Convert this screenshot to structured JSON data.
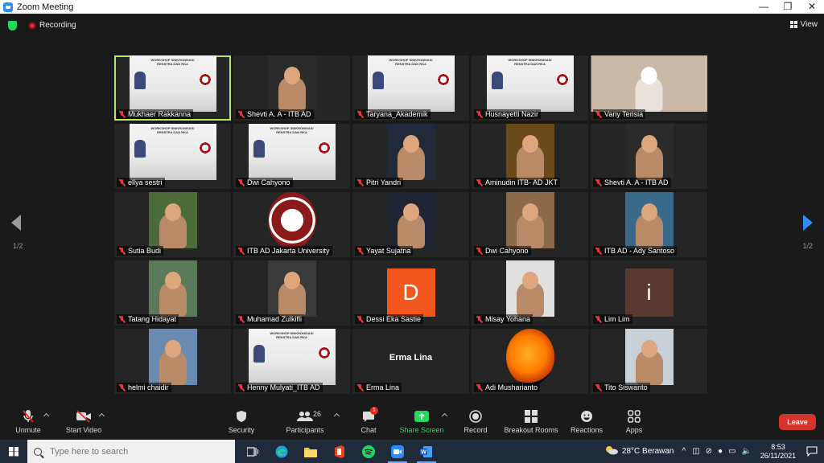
{
  "window": {
    "title": "Zoom Meeting",
    "controls": [
      "—",
      "❐",
      "✕"
    ]
  },
  "topbar": {
    "recording_label": "Recording",
    "view_label": "View"
  },
  "pagination": {
    "left": "1/2",
    "right": "1/2"
  },
  "participants": [
    {
      "name": "Mukhaer Rakkanna",
      "kind": "slide",
      "active": true
    },
    {
      "name": "Shevti A. A - ITB AD",
      "kind": "face",
      "color": "#2b2b2b"
    },
    {
      "name": "Taryana_Akademik",
      "kind": "slide"
    },
    {
      "name": "Husnayetti Nazir",
      "kind": "slide"
    },
    {
      "name": "Vany Terisia",
      "kind": "face-full",
      "color": "#c9b9a6"
    },
    {
      "name": "ellya sestri",
      "kind": "slide"
    },
    {
      "name": "Dwi Cahyono",
      "kind": "slide"
    },
    {
      "name": "Pitri Yandri",
      "kind": "face",
      "color": "#202a3a"
    },
    {
      "name": "Aminudin ITB- AD JKT",
      "kind": "face",
      "color": "#6b4a1a"
    },
    {
      "name": "Shevti A. A - ITB AD",
      "kind": "face",
      "color": "#2b2b2b"
    },
    {
      "name": "Sutia Budi",
      "kind": "face",
      "color": "#4b6b3a"
    },
    {
      "name": "ITB AD Jakarta University",
      "kind": "seal"
    },
    {
      "name": "Yayat Sujatna",
      "kind": "face",
      "color": "#1e2432"
    },
    {
      "name": "Dwi Cahyono",
      "kind": "face",
      "color": "#8a6a4a"
    },
    {
      "name": "ITB AD - Ady Santoso",
      "kind": "face",
      "color": "#3a6a8a"
    },
    {
      "name": "Tatang Hidayat",
      "kind": "face",
      "color": "#5a7a5a"
    },
    {
      "name": "Muhamad Zulkifli",
      "kind": "face",
      "color": "#3a3a3a"
    },
    {
      "name": "Dessi Eka Sastie",
      "kind": "letter",
      "letter": "D",
      "color": "#f2581e"
    },
    {
      "name": "Misay Yohana",
      "kind": "face",
      "color": "#e0e0e0"
    },
    {
      "name": "Lim Lim",
      "kind": "letter",
      "letter": "i",
      "color": "#5a3a30"
    },
    {
      "name": "helmi chaidir",
      "kind": "face",
      "color": "#6a8ab0"
    },
    {
      "name": "Henny Mulyati_ITB AD",
      "kind": "slide"
    },
    {
      "name": "Erma Lina",
      "kind": "nameonly"
    },
    {
      "name": "Adi Musharianto",
      "kind": "sun"
    },
    {
      "name": "Tito Siswanto",
      "kind": "face",
      "color": "#c8d0d8"
    }
  ],
  "toolbar": {
    "unmute": "Unmute",
    "start_video": "Start Video",
    "security": "Security",
    "participants": "Participants",
    "participants_count": "26",
    "chat": "Chat",
    "chat_badge": "1",
    "share_screen": "Share Screen",
    "record": "Record",
    "breakout_rooms": "Breakout Rooms",
    "reactions": "Reactions",
    "apps": "Apps",
    "leave": "Leave"
  },
  "taskbar": {
    "search_placeholder": "Type here to search",
    "weather": "28°C  Berawan",
    "time": "8:53",
    "date": "26/11/2021"
  },
  "colors": {
    "accent": "#2d8cff",
    "green": "#23d959",
    "leave": "#d4342b",
    "active_speaker": "#b6e86a"
  }
}
